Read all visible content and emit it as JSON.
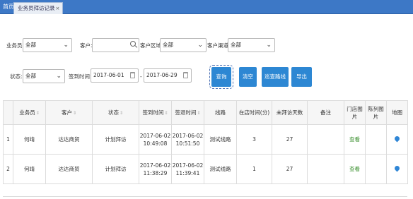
{
  "tabs": {
    "home_label": "首页",
    "active_label": "业务员拜访记录",
    "close_glyph": "×"
  },
  "filters": {
    "salesperson_label": "业务员:",
    "salesperson_value": "全部",
    "customer_label": "客户:",
    "customer_value": "",
    "region_label": "客户区域:",
    "region_value": "全部",
    "channel_label": "客户渠道:",
    "channel_value": "全部",
    "status_label": "状态:",
    "status_value": "全部",
    "signin_time_label": "签到时间:",
    "date_from": "2017-06-01",
    "date_sep": "-",
    "date_to": "2017-06-29"
  },
  "buttons": {
    "query": "查询",
    "clear": "清空",
    "route": "巡查路线",
    "export": "导出"
  },
  "table": {
    "headers": [
      "",
      "业务员",
      "客户",
      "状态",
      "签到时间",
      "签退时间",
      "线路",
      "在店时间(分)",
      "未拜访天数",
      "备注",
      "门店图片",
      "陈列图片",
      "地图"
    ],
    "sortable": [
      false,
      true,
      true,
      true,
      true,
      true,
      false,
      false,
      false,
      false,
      false,
      false,
      false
    ],
    "rows": [
      {
        "index": "1",
        "salesperson": "何靖",
        "customer": "达达商贸",
        "status": "计划拜访",
        "signin_date": "2017-06-02",
        "signin_time": "10:49:08",
        "signout_date": "2017-06-02",
        "signout_time": "10:51:50",
        "route": "测试线路",
        "minutes_in_store": "3",
        "days_unvisited": "27",
        "remark": "",
        "store_image": "查看",
        "display_image": ""
      },
      {
        "index": "2",
        "salesperson": "何靖",
        "customer": "达达商贸",
        "status": "计划拜访",
        "signin_date": "2017-06-02",
        "signin_time": "11:38:29",
        "signout_date": "2017-06-02",
        "signout_time": "11:39:41",
        "route": "测试线路",
        "minutes_in_store": "1",
        "days_unvisited": "27",
        "remark": "",
        "store_image": "查看",
        "display_image": ""
      }
    ]
  },
  "colors": {
    "tabbar": "#3d78c6",
    "button": "#2d87d3",
    "link_green": "#3a8f2e",
    "map_pin": "#2f86d6"
  },
  "icons": {
    "dropdown": "chevron-down-icon",
    "search": "search-icon",
    "calendar": "calendar-icon",
    "map": "map-pin-icon"
  }
}
